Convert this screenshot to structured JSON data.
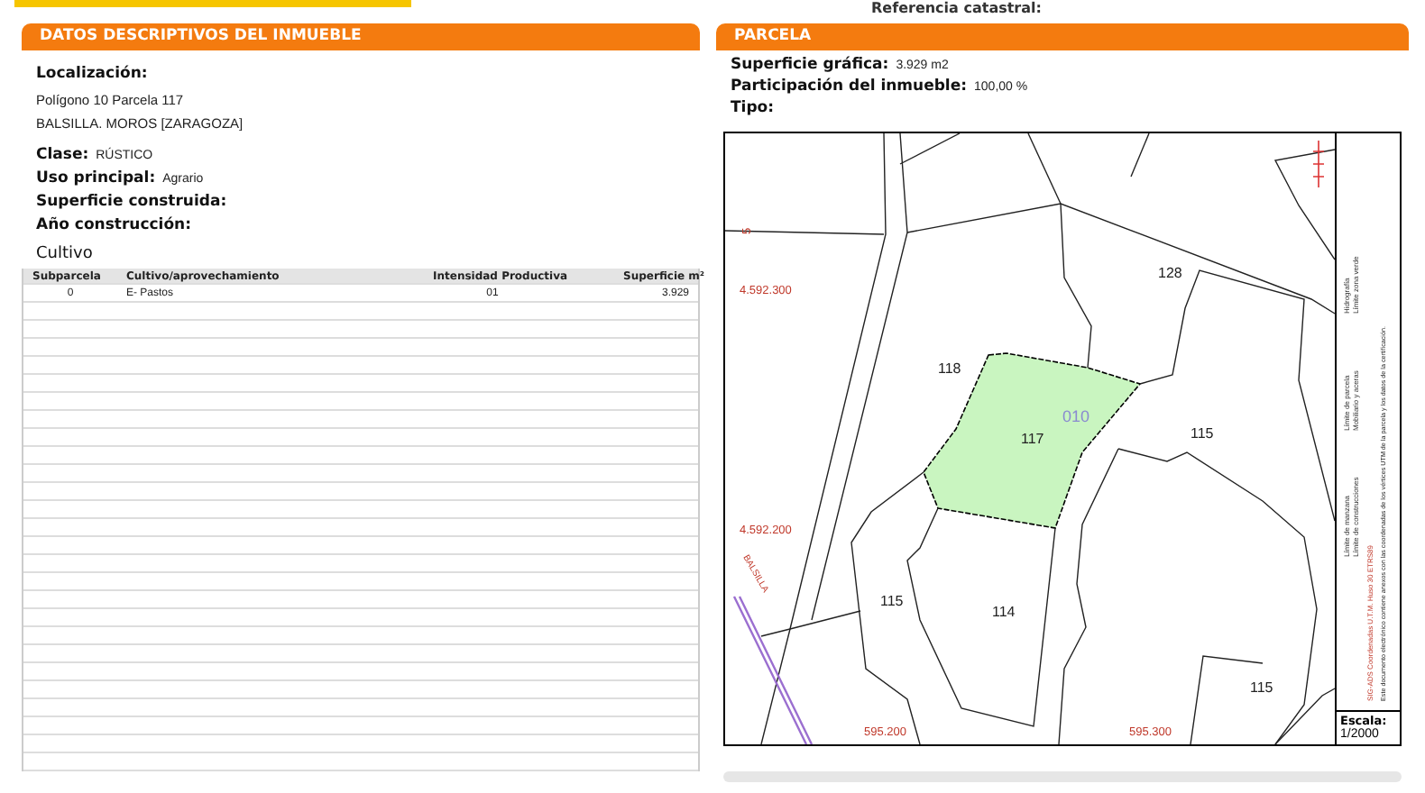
{
  "top_bar": {
    "label": "Referencia catastral:"
  },
  "descriptive_panel": {
    "title": "DATOS DESCRIPTIVOS DEL INMUEBLE",
    "location_label": "Localización:",
    "location_lines": [
      "Polígono 10 Parcela 117",
      "BALSILLA. MOROS [ZARAGOZA]"
    ],
    "fields": [
      {
        "label": "Clase:",
        "value": "RÚSTICO"
      },
      {
        "label": "Uso principal:",
        "value": "Agrario"
      },
      {
        "label": "Superficie construida:"
      },
      {
        "label": "Año construcción:"
      }
    ],
    "cultivo": {
      "title": "Cultivo",
      "columns": [
        "Subparcela",
        "Cultivo/aprovechamiento",
        "Intensidad Productiva",
        "Superficie m²"
      ],
      "rows": [
        [
          "0",
          "E- Pastos",
          "01",
          "3.929"
        ]
      ]
    }
  },
  "parcel_panel": {
    "title": "PARCELA",
    "fields": [
      {
        "label": "Superficie gráfica:",
        "value": "3.929 m2"
      },
      {
        "label": "Participación del inmueble:",
        "value": "100,00 %"
      },
      {
        "label": "Tipo:"
      }
    ],
    "map": {
      "parcel_labels": [
        {
          "text": "128",
          "kind": "neighbour"
        },
        {
          "text": "118",
          "kind": "neighbour"
        },
        {
          "text": "010",
          "kind": "subparcel"
        },
        {
          "text": "117",
          "kind": "neighbour"
        },
        {
          "text": "115",
          "kind": "neighbour"
        },
        {
          "text": "115",
          "kind": "neighbour"
        },
        {
          "text": "114",
          "kind": "neighbour"
        },
        {
          "text": "115",
          "kind": "neighbour"
        }
      ],
      "coordinate_labels": [
        "5",
        "4.592.300",
        "4.592.200",
        "595.200",
        "595.300"
      ],
      "road_label": "BALSILLA",
      "legend": [
        "Límite de manzana",
        "Límite de construcciones",
        "Límite de parcela",
        "Mobiliario y aceras",
        "Hidrografía",
        "Límite zona verde"
      ],
      "legend_projection": "SIG-ADS Coordenadas U.T.M. Huso 30 ETRS89",
      "legend_note": "Este documento electrónico contiene anexos con las coordenadas de los vértices UTM de la parcela y los datos de la certificación.",
      "scale_label": "Escala:",
      "scale_value": "1/2000"
    }
  }
}
